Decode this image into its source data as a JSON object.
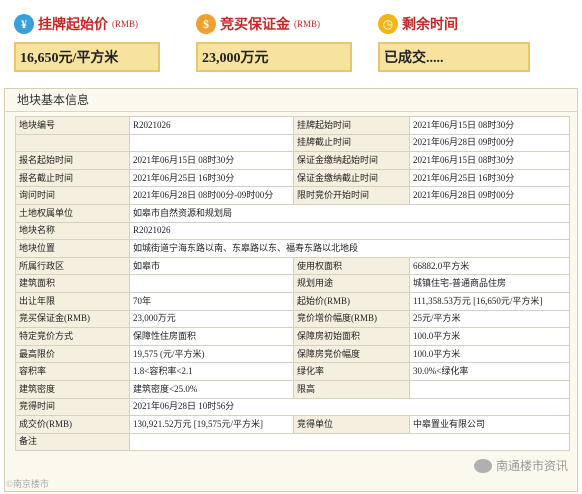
{
  "header": {
    "listing_price": {
      "label": "挂牌起始价",
      "unit": "(RMB)",
      "value": "16,650元/平方米",
      "icon": "price-tag-icon"
    },
    "deposit": {
      "label": "竞买保证金",
      "unit": "(RMB)",
      "value": "23,000万元",
      "icon": "money-bag-icon"
    },
    "remaining": {
      "label": "剩余时间",
      "value": "已成交.....",
      "icon": "clock-icon"
    }
  },
  "panel": {
    "title": "地块基本信息"
  },
  "rows": [
    [
      "地块编号",
      "R2021026",
      "挂牌起始时间",
      "2021年06月15日 08时30分"
    ],
    [
      "",
      "",
      "挂牌截止时间",
      "2021年06月28日 09时00分"
    ],
    [
      "报名起始时间",
      "2021年06月15日 08时30分",
      "保证金缴纳起始时间",
      "2021年06月15日 08时30分"
    ],
    [
      "报名截止时间",
      "2021年06月25日 16时30分",
      "保证金缴纳截止时间",
      "2021年06月25日 16时30分"
    ],
    [
      "询问时间",
      "2021年06月28日 08时00分-09时00分",
      "限时竞价开始时间",
      "2021年06月28日 09时00分"
    ],
    [
      "土地权属单位",
      "如皋市自然资源和规划局"
    ],
    [
      "地块名称",
      "R2021026"
    ],
    [
      "地块位置",
      "如城街道宁海东路以南、东皋路以东、福寿东路以北地段"
    ],
    [
      "所属行政区",
      "如皋市",
      "使用权面积",
      "66882.0平方米"
    ],
    [
      "建筑面积",
      "",
      "规划用途",
      "城镇住宅-普通商品住房"
    ],
    [
      "出让年限",
      "70年",
      "起始价(RMB)",
      "111,358.53万元 [16,650元/平方米]"
    ],
    [
      "竞买保证金(RMB)",
      "23,000万元",
      "竞价增价幅度(RMB)",
      "25元/平方米"
    ],
    [
      "特定竞价方式",
      "保障性住房面积",
      "保障房初始面积",
      "100.0平方米"
    ],
    [
      "最高限价",
      "19,575 (元/平方米)",
      "保障房竞价幅度",
      "100.0平方米"
    ],
    [
      "容积率",
      "1.8<容积率<2.1",
      "绿化率",
      "30.0%<绿化率"
    ],
    [
      "建筑密度",
      "建筑密度<25.0%",
      "限高",
      ""
    ],
    [
      "竞得时间",
      "2021年06月28日 10时56分"
    ],
    [
      "成交价(RMB)",
      "130,921.52万元 [19,575元/平方米]",
      "竞得单位",
      "中皋置业有限公司"
    ],
    [
      "备注",
      ""
    ]
  ],
  "watermark": {
    "text": "南通楼市资讯",
    "icon": "wechat-icon"
  },
  "watermark2": {
    "text": "©南京楼市"
  }
}
